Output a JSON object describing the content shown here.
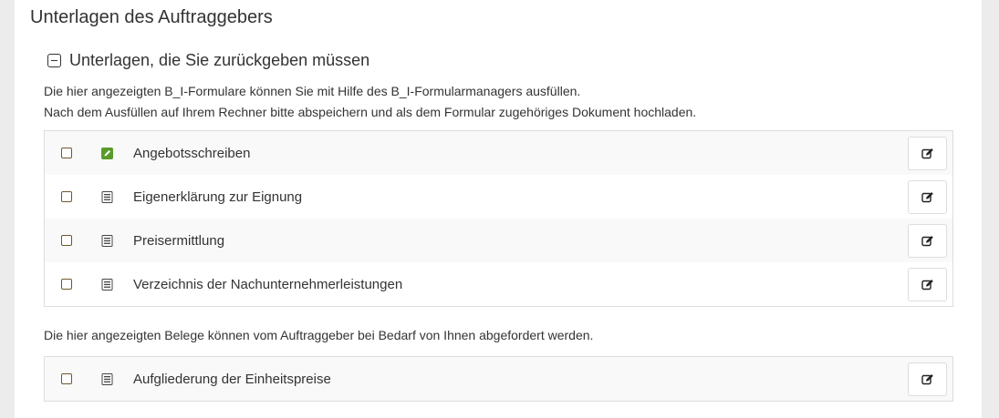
{
  "page": {
    "title": "Unterlagen des Auftraggebers"
  },
  "section": {
    "title": "Unterlagen, die Sie zurückgeben müssen",
    "info_line1": "Die hier angezeigten B_I-Formulare können Sie mit Hilfe des B_I-Formularmanagers ausfüllen.",
    "info_line2": "Nach dem Ausfüllen auf Ihrem Rechner bitte abspeichern und als dem Formular zugehöriges Dokument hochladen."
  },
  "forms": [
    {
      "label": "Angebotsschreiben",
      "icon": "green-edit-icon"
    },
    {
      "label": "Eigenerklärung zur Eignung",
      "icon": "form-document-icon"
    },
    {
      "label": "Preisermittlung",
      "icon": "form-document-icon"
    },
    {
      "label": "Verzeichnis der Nachunternehmerleistungen",
      "icon": "form-document-icon"
    }
  ],
  "belege_info": "Die hier angezeigten Belege können vom Auftraggeber bei Bedarf von Ihnen abgefordert werden.",
  "belege": [
    {
      "label": "Aufgliederung der Einheitspreise",
      "icon": "form-document-icon"
    }
  ],
  "colors": {
    "accent_green": "#5a9a2a",
    "border": "#dddddd",
    "row_alt": "#f9f9f9"
  }
}
